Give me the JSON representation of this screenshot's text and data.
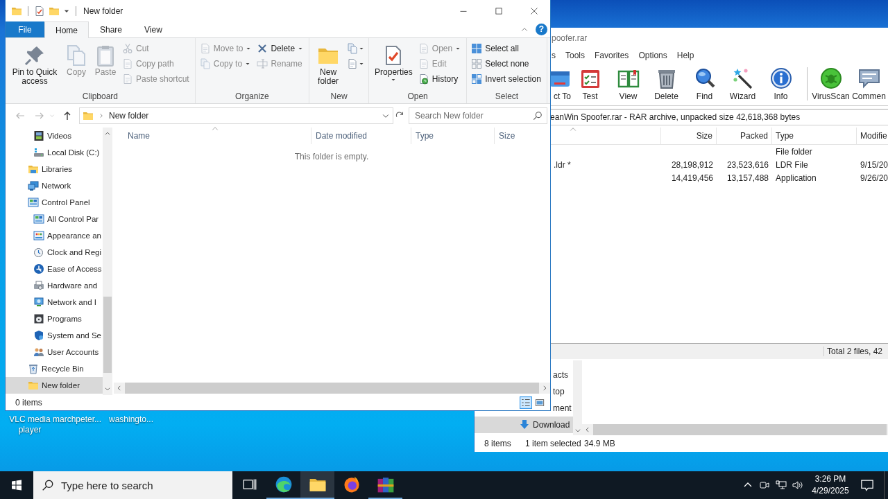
{
  "desktop_icons": [
    {
      "label": "VLC media player"
    },
    {
      "label": "marchpeter..."
    },
    {
      "label": "washingto..."
    }
  ],
  "explorer_behind": {
    "nav_items": [
      {
        "label": "acts",
        "selected": false
      },
      {
        "label": "top",
        "selected": false
      },
      {
        "label": "ment",
        "selected": false
      },
      {
        "label": "Download",
        "selected": true
      }
    ],
    "status": {
      "items": "8 items",
      "selection": "1 item selected",
      "size": "34.9 MB"
    }
  },
  "winrar": {
    "title": "poofer.rar",
    "menu": [
      "s",
      "Tools",
      "Favorites",
      "Options",
      "Help"
    ],
    "toolbar": [
      [
        {
          "label": "ct To"
        },
        {
          "label": "Test"
        },
        {
          "label": "View"
        },
        {
          "label": "Delete"
        },
        {
          "label": "Find"
        },
        {
          "label": "Wizard"
        },
        {
          "label": "Info"
        }
      ],
      [
        {
          "label": "VirusScan"
        },
        {
          "label": "Commen"
        }
      ]
    ],
    "path": "eanWin Spoofer.rar - RAR archive, unpacked size 42,618,368 bytes",
    "columns": [
      {
        "label": "Size"
      },
      {
        "label": "Packed"
      },
      {
        "label": "Type"
      },
      {
        "label": "Modifie"
      }
    ],
    "rows": [
      {
        "type": "File folder"
      },
      {
        "name": ".ldr *",
        "size": "28,198,912",
        "packed": "23,523,616",
        "type": "LDR File",
        "modified": "9/15/20"
      },
      {
        "size": "14,419,456",
        "packed": "13,157,488",
        "type": "Application",
        "modified": "9/26/20"
      }
    ],
    "status": "Total 2 files, 42"
  },
  "explorer": {
    "title": "New folder",
    "help": "?",
    "tabs": [
      {
        "label": "File",
        "kind": "file",
        "selected": false
      },
      {
        "label": "Home",
        "kind": "tab",
        "selected": true
      },
      {
        "label": "Share",
        "kind": "tab",
        "selected": false
      },
      {
        "label": "View",
        "kind": "tab",
        "selected": false
      }
    ],
    "ribbon_groups": [
      {
        "label": "Clipboard",
        "columns": [
          [
            {
              "label": "Pin to Quick access",
              "kind": "large",
              "disabled": false
            }
          ],
          [
            {
              "label": "Copy",
              "kind": "large",
              "disabled": true
            }
          ],
          [
            {
              "label": "Paste",
              "kind": "large",
              "disabled": true
            }
          ],
          [
            {
              "label": "Cut",
              "kind": "small",
              "disabled": true
            },
            {
              "label": "Copy path",
              "kind": "small",
              "disabled": true
            },
            {
              "label": "Paste shortcut",
              "kind": "small",
              "disabled": true
            }
          ]
        ]
      },
      {
        "label": "Organize",
        "columns": [
          [
            {
              "label": "Move to",
              "kind": "small",
              "disabled": true,
              "dropdown": true
            },
            {
              "label": "Copy to",
              "kind": "small",
              "disabled": true,
              "dropdown": true
            }
          ],
          [
            {
              "label": "Delete",
              "kind": "small",
              "disabled": false,
              "dropdown": true
            },
            {
              "label": "Rename",
              "kind": "small",
              "disabled": true
            }
          ]
        ]
      },
      {
        "label": "New",
        "columns": [
          [
            {
              "label": "New folder",
              "kind": "large",
              "disabled": false
            }
          ],
          [
            {
              "kind": "icon",
              "disabled": false,
              "dropdown": true
            },
            {
              "kind": "icon",
              "disabled": false,
              "dropdown": true
            }
          ]
        ]
      },
      {
        "label": "Open",
        "columns": [
          [
            {
              "label": "Properties",
              "kind": "large",
              "disabled": false,
              "dropdown": true
            }
          ],
          [
            {
              "label": "Open",
              "kind": "small",
              "disabled": true,
              "dropdown": true
            },
            {
              "label": "Edit",
              "kind": "small",
              "disabled": true
            },
            {
              "label": "History",
              "kind": "small",
              "disabled": false
            }
          ]
        ]
      },
      {
        "label": "Select",
        "columns": [
          [
            {
              "label": "Select all",
              "kind": "small",
              "disabled": false
            },
            {
              "label": "Select none",
              "kind": "small",
              "disabled": false
            },
            {
              "label": "Invert selection",
              "kind": "small",
              "disabled": false
            }
          ]
        ]
      }
    ],
    "address": "New folder",
    "search": {
      "placeholder": "Search New folder"
    },
    "nav_pane": {
      "items": [
        {
          "children": [
            {
              "label": "Videos",
              "selected": false
            },
            {
              "label": "Local Disk (C:)",
              "selected": false
            }
          ]
        },
        {
          "label": "Libraries",
          "selected": false
        },
        {
          "label": "Network",
          "selected": false
        },
        {
          "label": "Control Panel",
          "selected": false,
          "children": [
            {
              "label": "All Control Par",
              "selected": false
            },
            {
              "label": "Appearance an",
              "selected": false
            },
            {
              "label": "Clock and Regi",
              "selected": false
            },
            {
              "label": "Ease of Access",
              "selected": false
            },
            {
              "label": "Hardware and",
              "selected": false
            },
            {
              "label": "Network and I",
              "selected": false
            },
            {
              "label": "Programs",
              "selected": false
            },
            {
              "label": "System and Se",
              "selected": false
            },
            {
              "label": "User Accounts",
              "selected": false
            }
          ]
        },
        {
          "label": "Recycle Bin",
          "selected": false
        },
        {
          "label": "New folder",
          "selected": true
        }
      ]
    },
    "columns": [
      {
        "label": "Name"
      },
      {
        "label": "Date modified"
      },
      {
        "label": "Type"
      },
      {
        "label": "Size"
      }
    ],
    "empty_message": "This folder is empty.",
    "status": "0 items"
  },
  "taskbar": {
    "search": {
      "placeholder": "Type here to search"
    },
    "apps": [
      {
        "running": true,
        "selected": false
      },
      {
        "running": true,
        "selected": true
      },
      {
        "running": false,
        "selected": false
      },
      {
        "running": true,
        "selected": false
      }
    ],
    "clock": {
      "time": "3:26 PM",
      "date": "4/29/2025"
    }
  }
}
